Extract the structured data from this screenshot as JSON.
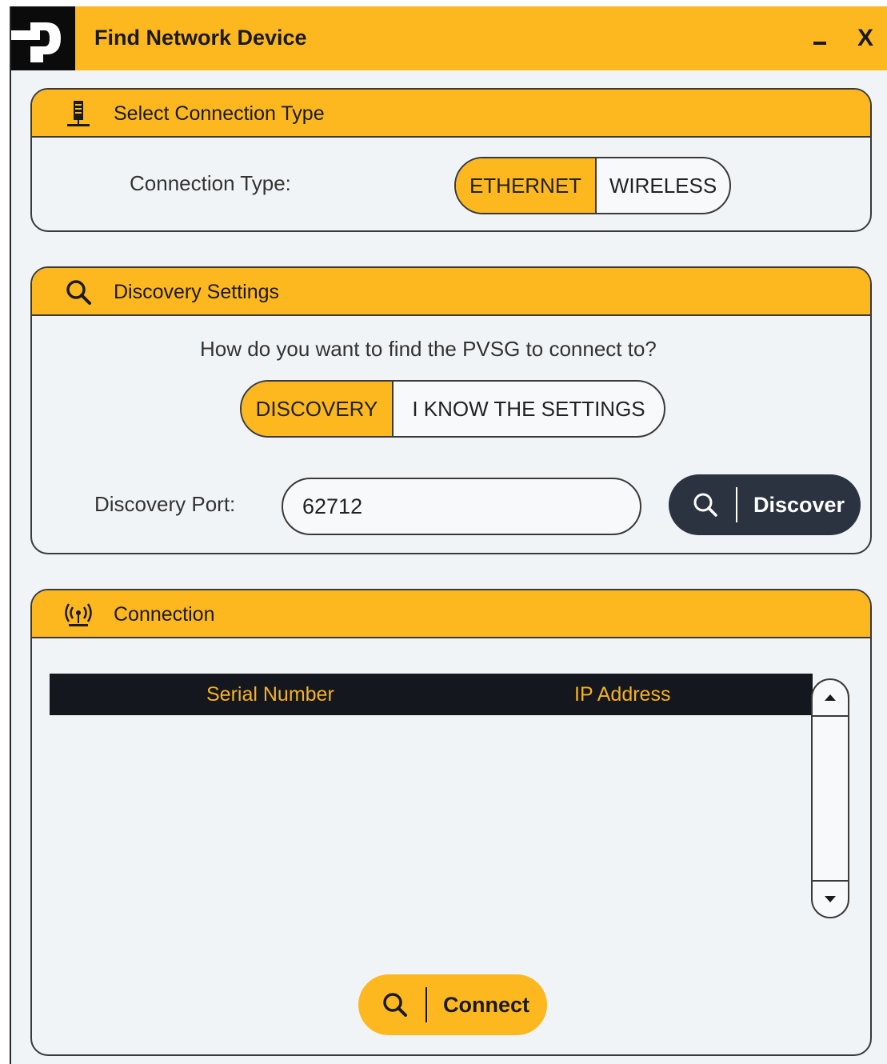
{
  "window": {
    "title": "Find Network Device",
    "minimize_label": "_",
    "close_label": "X"
  },
  "connection_type_panel": {
    "heading": "Select Connection Type",
    "label": "Connection Type:",
    "options": [
      "ETHERNET",
      "WIRELESS"
    ],
    "selected": "ETHERNET"
  },
  "discovery_panel": {
    "heading": "Discovery Settings",
    "question": "How do you want to find the PVSG to connect to?",
    "options": [
      "DISCOVERY",
      "I KNOW THE SETTINGS"
    ],
    "selected": "DISCOVERY",
    "port_label": "Discovery Port:",
    "port_value": "62712",
    "discover_label": "Discover"
  },
  "connection_panel": {
    "heading": "Connection",
    "columns": [
      "Serial Number",
      "IP Address"
    ],
    "rows": [],
    "connect_label": "Connect"
  },
  "colors": {
    "accent": "#fdb71f",
    "dark": "#15171f",
    "button_dark": "#2b3341",
    "background": "#f1f4f7"
  }
}
